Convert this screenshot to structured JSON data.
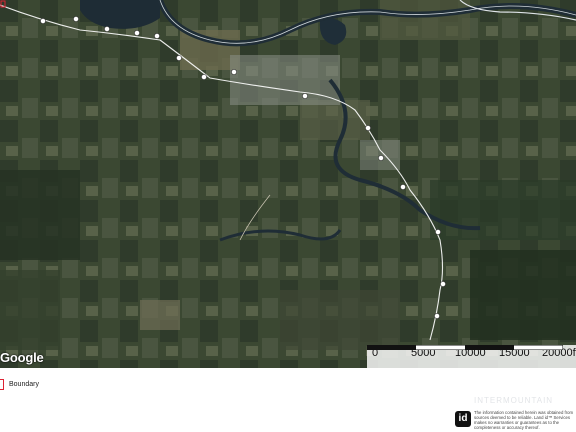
{
  "map": {
    "type": "satellite",
    "provider_logo": "Google",
    "property_marker_icon": "red-boundary-outline",
    "route_marker_icon": "route-shield-icon"
  },
  "scale_bar": {
    "labels": [
      "0",
      "5000",
      "10000",
      "15000",
      "20000ft"
    ]
  },
  "legend": {
    "items": [
      {
        "label": "Boundary",
        "color": "#dd2233"
      }
    ]
  },
  "footer": {
    "watermark": "INTERMOUNTAIN",
    "brand_logo": "id",
    "disclaimer": "The information contained herein was obtained from sources deemed to be reliable. Land id™ Services makes no warranties or guarantees as to the completeness or accuracy thereof."
  },
  "colors": {
    "boundary": "#dd2233",
    "river": "#1f2d36",
    "road": "#ffffff"
  }
}
